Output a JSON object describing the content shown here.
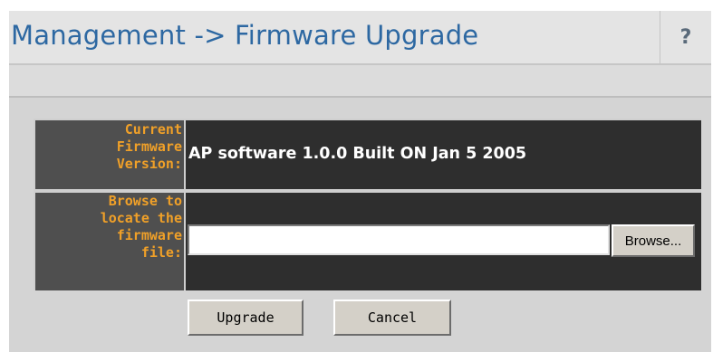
{
  "header": {
    "title": "Management -> Firmware Upgrade",
    "help_label": "?"
  },
  "form": {
    "current_version": {
      "label_lines": [
        "Current",
        "Firmware",
        "Version:"
      ],
      "value": "AP software 1.0.0 Built ON Jan 5 2005"
    },
    "file": {
      "label_lines": [
        "Browse to",
        "locate the",
        "firmware",
        "file:"
      ],
      "input_value": "",
      "browse_label": "Browse..."
    }
  },
  "actions": {
    "upgrade_label": "Upgrade",
    "cancel_label": "Cancel"
  },
  "colors": {
    "title": "#2d68a2",
    "label_text": "#f0a028",
    "label_bg": "#4f4f4f",
    "value_bg": "#2e2e2e",
    "page_bg": "#d4d4d4"
  },
  "icons": {
    "help": "help-icon"
  }
}
